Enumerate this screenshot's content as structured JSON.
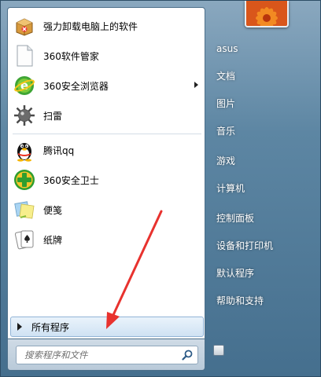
{
  "start_menu": {
    "programs": [
      {
        "label": "强力卸载电脑上的软件",
        "icon": "uninstall-box-icon",
        "has_submenu": false
      },
      {
        "label": "360软件管家",
        "icon": "blank-document-icon",
        "has_submenu": false
      },
      {
        "label": "360安全浏览器",
        "icon": "360-browser-icon",
        "has_submenu": true
      },
      {
        "label": "扫雷",
        "icon": "minesweeper-icon",
        "has_submenu": false
      },
      {
        "label": "腾讯qq",
        "icon": "qq-penguin-icon",
        "has_submenu": false
      },
      {
        "label": "360安全卫士",
        "icon": "360-guard-icon",
        "has_submenu": false
      },
      {
        "label": "便笺",
        "icon": "sticky-notes-icon",
        "has_submenu": false
      },
      {
        "label": "纸牌",
        "icon": "solitaire-icon",
        "has_submenu": false
      }
    ],
    "all_programs_label": "所有程序",
    "search": {
      "placeholder": "搜索程序和文件"
    },
    "right_links": [
      {
        "label": "asus"
      },
      {
        "label": "文档"
      },
      {
        "label": "图片"
      },
      {
        "label": "音乐"
      },
      {
        "label": "游戏"
      },
      {
        "label": "计算机"
      },
      {
        "label": "控制面板"
      },
      {
        "label": "设备和打印机"
      },
      {
        "label": "默认程序"
      },
      {
        "label": "帮助和支持"
      }
    ]
  },
  "colors": {
    "annotation_arrow": "#e8322e",
    "all_programs_bg": "#cfe2f3",
    "menu_blue": "#5d86a3"
  }
}
